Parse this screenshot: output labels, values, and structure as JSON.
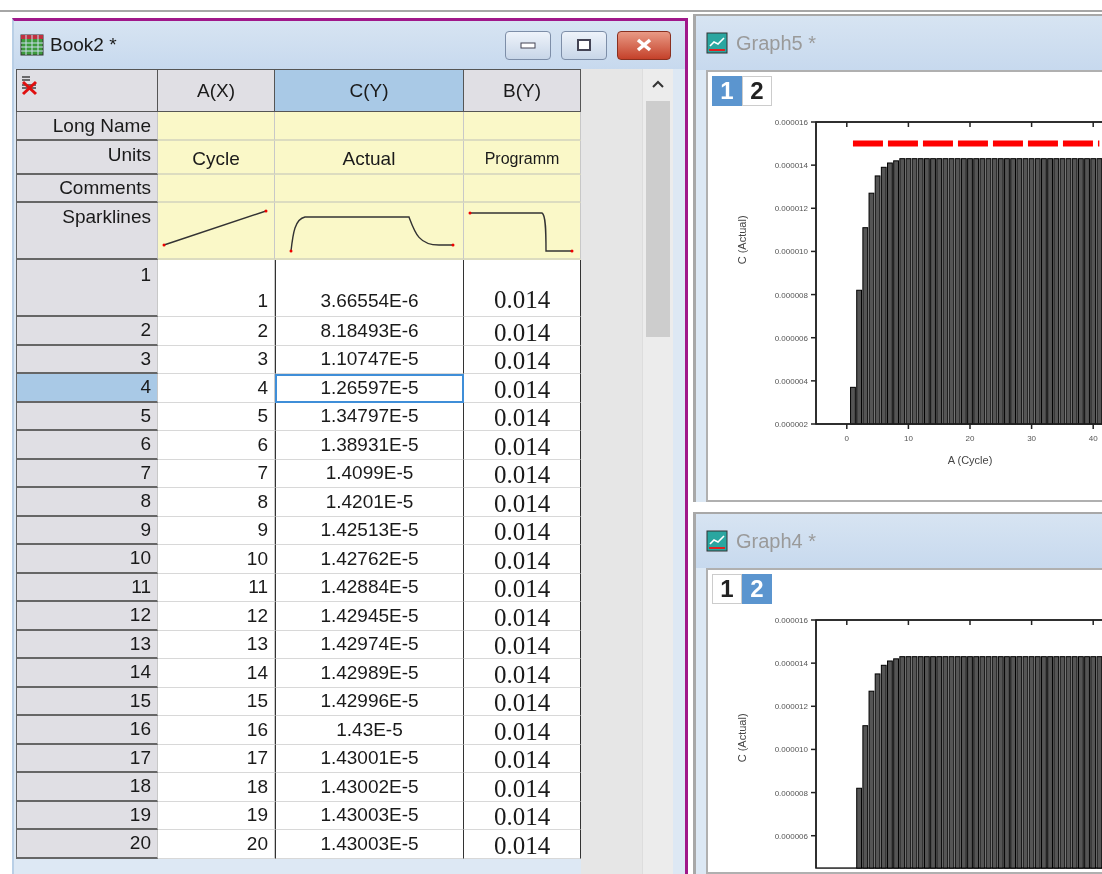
{
  "worksheet": {
    "title": "Book2 *",
    "active": true,
    "columns": [
      {
        "header": "A(X)",
        "selected": false,
        "units": "Cycle",
        "kind": "rising"
      },
      {
        "header": "C(Y)",
        "selected": true,
        "units": "Actual",
        "kind": "plateau"
      },
      {
        "header": "B(Y)",
        "selected": false,
        "units": "Programm",
        "kind": "step"
      }
    ],
    "label_rows": [
      "Long Name",
      "Units",
      "Comments",
      "Sparklines"
    ],
    "rows": [
      {
        "label": "1",
        "a": "1",
        "c": "3.66554E-6",
        "b": "0.014",
        "selected": false
      },
      {
        "label": "2",
        "a": "2",
        "c": "8.18493E-6",
        "b": "0.014",
        "selected": false
      },
      {
        "label": "3",
        "a": "3",
        "c": "1.10747E-5",
        "b": "0.014",
        "selected": false
      },
      {
        "label": "4",
        "a": "4",
        "c": "1.26597E-5",
        "b": "0.014",
        "selected": true
      },
      {
        "label": "5",
        "a": "5",
        "c": "1.34797E-5",
        "b": "0.014",
        "selected": false
      },
      {
        "label": "6",
        "a": "6",
        "c": "1.38931E-5",
        "b": "0.014",
        "selected": false
      },
      {
        "label": "7",
        "a": "7",
        "c": "1.4099E-5",
        "b": "0.014",
        "selected": false
      },
      {
        "label": "8",
        "a": "8",
        "c": "1.4201E-5",
        "b": "0.014",
        "selected": false
      },
      {
        "label": "9",
        "a": "9",
        "c": "1.42513E-5",
        "b": "0.014",
        "selected": false
      },
      {
        "label": "10",
        "a": "10",
        "c": "1.42762E-5",
        "b": "0.014",
        "selected": false
      },
      {
        "label": "11",
        "a": "11",
        "c": "1.42884E-5",
        "b": "0.014",
        "selected": false
      },
      {
        "label": "12",
        "a": "12",
        "c": "1.42945E-5",
        "b": "0.014",
        "selected": false
      },
      {
        "label": "13",
        "a": "13",
        "c": "1.42974E-5",
        "b": "0.014",
        "selected": false
      },
      {
        "label": "14",
        "a": "14",
        "c": "1.42989E-5",
        "b": "0.014",
        "selected": false
      },
      {
        "label": "15",
        "a": "15",
        "c": "1.42996E-5",
        "b": "0.014",
        "selected": false
      },
      {
        "label": "16",
        "a": "16",
        "c": "1.43E-5",
        "b": "0.014",
        "selected": false
      },
      {
        "label": "17",
        "a": "17",
        "c": "1.43001E-5",
        "b": "0.014",
        "selected": false
      },
      {
        "label": "18",
        "a": "18",
        "c": "1.43002E-5",
        "b": "0.014",
        "selected": false
      },
      {
        "label": "19",
        "a": "19",
        "c": "1.43003E-5",
        "b": "0.014",
        "selected": false
      },
      {
        "label": "20",
        "a": "20",
        "c": "1.43003E-5",
        "b": "0.014",
        "selected": false
      }
    ]
  },
  "graphs": [
    {
      "title": "Graph5 *",
      "active": false,
      "layers": [
        {
          "label": "1",
          "selected": true
        },
        {
          "label": "2",
          "selected": false
        }
      ],
      "chart_data": {
        "type": "bar",
        "xlabel": "A (Cycle)",
        "ylabel": "C (Actual)",
        "x": [
          1,
          2,
          3,
          4,
          5,
          6,
          7,
          8,
          9,
          10,
          11,
          12,
          13,
          14,
          15,
          16,
          17,
          18,
          19,
          20,
          21,
          22,
          23,
          24,
          25,
          26,
          27,
          28,
          29,
          30,
          31,
          32,
          33,
          34,
          35,
          36,
          37,
          38,
          39,
          40,
          41
        ],
        "series": [
          {
            "color": "#555555",
            "values": [
              3.7e-06,
              8.2e-06,
              1.11e-05,
              1.27e-05,
              1.35e-05,
              1.39e-05,
              1.41e-05,
              1.42e-05,
              1.43e-05,
              1.43e-05,
              1.43e-05,
              1.43e-05,
              1.43e-05,
              1.43e-05,
              1.43e-05,
              1.43e-05,
              1.43e-05,
              1.43e-05,
              1.43e-05,
              1.43e-05,
              1.43e-05,
              1.43e-05,
              1.43e-05,
              1.43e-05,
              1.43e-05,
              1.43e-05,
              1.43e-05,
              1.43e-05,
              1.43e-05,
              1.43e-05,
              1.43e-05,
              1.43e-05,
              1.43e-05,
              1.43e-05,
              1.43e-05,
              1.43e-05,
              1.43e-05,
              1.43e-05,
              1.43e-05,
              1.43e-05,
              1.43e-05
            ]
          },
          {
            "type": "line",
            "line_style": "dashed",
            "color": "#ff0000",
            "values": [
              1.5e-05,
              1.5e-05,
              1.5e-05,
              1.5e-05,
              1.5e-05,
              1.5e-05,
              1.5e-05,
              1.5e-05,
              1.5e-05,
              1.5e-05,
              1.5e-05,
              1.5e-05,
              1.5e-05,
              1.5e-05,
              1.5e-05,
              1.5e-05,
              1.5e-05,
              1.5e-05,
              1.5e-05,
              1.5e-05,
              1.5e-05,
              1.5e-05,
              1.5e-05,
              1.5e-05,
              1.5e-05,
              1.5e-05,
              1.5e-05,
              1.5e-05,
              1.5e-05,
              1.5e-05,
              1.5e-05,
              1.5e-05,
              1.5e-05,
              1.5e-05,
              1.5e-05,
              1.5e-05,
              1.5e-05,
              1.5e-05,
              1.5e-05,
              1.5e-05,
              1.5e-05
            ]
          }
        ],
        "xlim": [
          -5,
          45
        ],
        "ylim": [
          2e-06,
          1.6e-05
        ],
        "xticks": [
          0,
          10,
          20,
          30,
          40
        ],
        "yticks": [
          {
            "value": 2e-06,
            "label": "0.000002"
          },
          {
            "value": 4e-06,
            "label": "0.000004"
          },
          {
            "value": 6e-06,
            "label": "0.000006"
          },
          {
            "value": 8e-06,
            "label": "0.000008"
          },
          {
            "value": 1e-05,
            "label": "0.000010"
          },
          {
            "value": 1.2e-05,
            "label": "0.000012"
          },
          {
            "value": 1.4e-05,
            "label": "0.000014"
          },
          {
            "value": 1.6e-05,
            "label": "0.000016"
          }
        ]
      }
    },
    {
      "title": "Graph4 *",
      "active": false,
      "layers": [
        {
          "label": "1",
          "selected": false
        },
        {
          "label": "2",
          "selected": true
        }
      ],
      "chart_data": {
        "type": "bar",
        "ylabel": "C (Actual)",
        "x": [
          2,
          3,
          4,
          5,
          6,
          7,
          8,
          9,
          10,
          11,
          12,
          13,
          14,
          15,
          16,
          17,
          18,
          19,
          20,
          21,
          22,
          23,
          24,
          25,
          26,
          27,
          28,
          29,
          30,
          31,
          32,
          33,
          34,
          35,
          36,
          37,
          38,
          39,
          40,
          41
        ],
        "series": [
          {
            "color": "#555555",
            "values": [
              8.2e-06,
              1.11e-05,
              1.27e-05,
              1.35e-05,
              1.39e-05,
              1.41e-05,
              1.42e-05,
              1.43e-05,
              1.43e-05,
              1.43e-05,
              1.43e-05,
              1.43e-05,
              1.43e-05,
              1.43e-05,
              1.43e-05,
              1.43e-05,
              1.43e-05,
              1.43e-05,
              1.43e-05,
              1.43e-05,
              1.43e-05,
              1.43e-05,
              1.43e-05,
              1.43e-05,
              1.43e-05,
              1.43e-05,
              1.43e-05,
              1.43e-05,
              1.43e-05,
              1.43e-05,
              1.43e-05,
              1.43e-05,
              1.43e-05,
              1.43e-05,
              1.43e-05,
              1.43e-05,
              1.43e-05,
              1.43e-05,
              1.43e-05,
              1.43e-05
            ]
          }
        ],
        "xlim": [
          -5,
          45
        ],
        "ylim": [
          4.5e-06,
          1.6e-05
        ],
        "yticks": [
          {
            "value": 6e-06,
            "label": "0.000006"
          },
          {
            "value": 8e-06,
            "label": "0.000008"
          },
          {
            "value": 1e-05,
            "label": "0.000010"
          },
          {
            "value": 1.2e-05,
            "label": "0.000012"
          },
          {
            "value": 1.4e-05,
            "label": "0.000014"
          },
          {
            "value": 1.6e-05,
            "label": "0.000016"
          }
        ]
      }
    }
  ]
}
